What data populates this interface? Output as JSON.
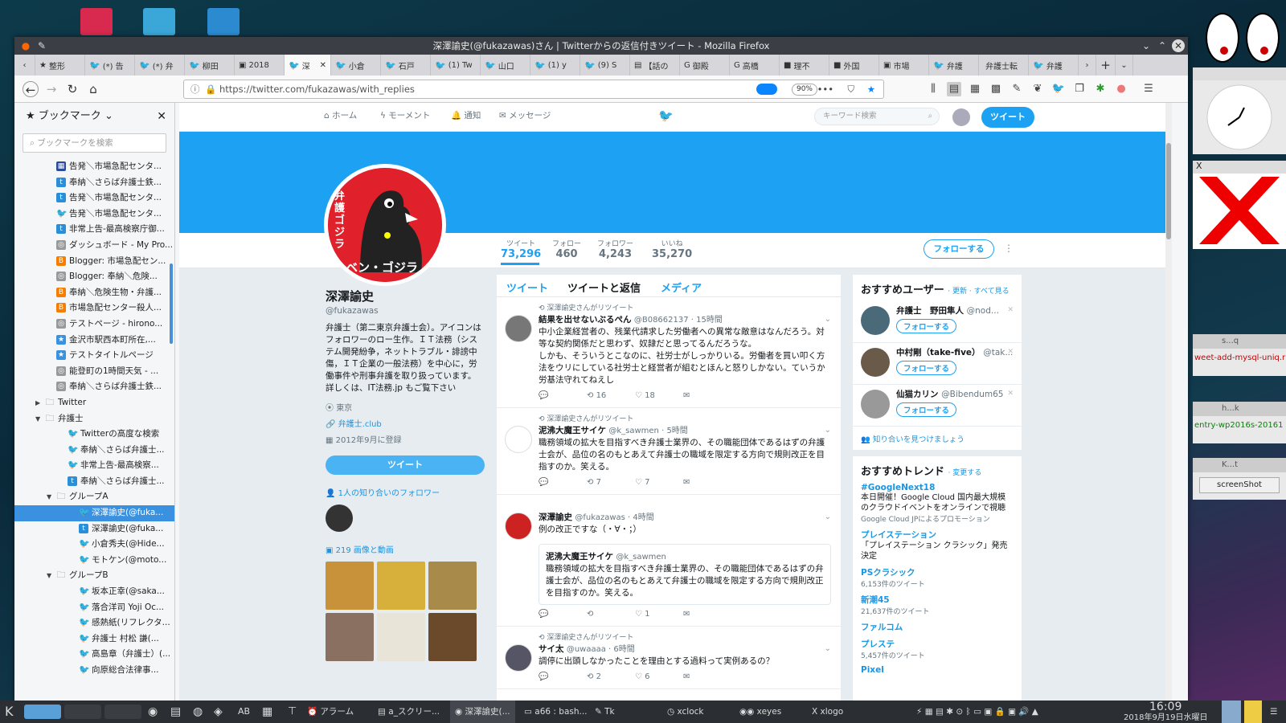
{
  "window_title": "深澤諭史(@fukazawas)さん | Twitterからの返信付きツイート - Mozilla Firefox",
  "tabs": [
    {
      "label": "整形",
      "icon": "star"
    },
    {
      "label": "(*) 告",
      "icon": "twitter"
    },
    {
      "label": "(*) 弁",
      "icon": "twitter"
    },
    {
      "label": "柳田",
      "icon": "twitter"
    },
    {
      "label": "2018",
      "icon": "photo"
    },
    {
      "label": "深",
      "icon": "twitter",
      "active": true
    },
    {
      "label": "小倉",
      "icon": "twitter"
    },
    {
      "label": "石戸",
      "icon": "twitter"
    },
    {
      "label": "(1) Tw",
      "icon": "twitter"
    },
    {
      "label": "山口",
      "icon": "twitter"
    },
    {
      "label": "(1) y",
      "icon": "twitter"
    },
    {
      "label": "(9) S",
      "icon": "twitter"
    },
    {
      "label": "【話の",
      "icon": "news"
    },
    {
      "label": "御殿",
      "icon": "g"
    },
    {
      "label": "高橋",
      "icon": "g"
    },
    {
      "label": "理不",
      "icon": "blue"
    },
    {
      "label": "外国",
      "icon": "blue"
    },
    {
      "label": "市場",
      "icon": "photo"
    },
    {
      "label": "弁護",
      "icon": "twitter"
    },
    {
      "label": "弁護士転",
      "icon": "none"
    },
    {
      "label": "弁護",
      "icon": "twitter"
    }
  ],
  "url": "https://twitter.com/fukazawas/with_replies",
  "zoom": "90%",
  "sidebar": {
    "title": "ブックマーク",
    "search_placeholder": "ブックマークを検索",
    "items": [
      {
        "label": "告発＼市場急配センタ...",
        "icon": "nv",
        "indent": 1
      },
      {
        "label": "奉納＼さらば弁護士鉄...",
        "icon": "bl",
        "indent": 1
      },
      {
        "label": "告発＼市場急配センタ...",
        "icon": "bl",
        "indent": 1
      },
      {
        "label": "告発＼市場急配センタ...",
        "icon": "tw",
        "indent": 1
      },
      {
        "label": "非常上告-最高検察庁御...",
        "icon": "bl",
        "indent": 1
      },
      {
        "label": "ダッシュボード - My Pro...",
        "icon": "gr",
        "indent": 1
      },
      {
        "label": "Blogger: 市場急配セン...",
        "icon": "or",
        "indent": 1
      },
      {
        "label": "Blogger: 奉納＼危険...",
        "icon": "gr",
        "indent": 1
      },
      {
        "label": "奉納＼危険生物・弁護...",
        "icon": "or",
        "indent": 1
      },
      {
        "label": "市場急配センター殺人...",
        "icon": "or",
        "indent": 1
      },
      {
        "label": "テストページ - hirono...",
        "icon": "gr",
        "indent": 1
      },
      {
        "label": "金沢市駅西本町所在,...",
        "icon": "st",
        "indent": 1
      },
      {
        "label": "テストタイトルページ",
        "icon": "st",
        "indent": 1
      },
      {
        "label": "能登町の1時間天気 - ...",
        "icon": "gr",
        "indent": 1
      },
      {
        "label": "奉納＼さらば弁護士鉄...",
        "icon": "gr",
        "indent": 1
      },
      {
        "label": "Twitter",
        "icon": "fd",
        "indent": 0,
        "arrow": "▶"
      },
      {
        "label": "弁護士",
        "icon": "fd",
        "indent": 0,
        "arrow": "▼"
      },
      {
        "label": "Twitterの高度な検索",
        "icon": "tw",
        "indent": 2
      },
      {
        "label": "奉納＼さらば弁護士...",
        "icon": "tw",
        "indent": 2
      },
      {
        "label": "非常上告-最高検察...",
        "icon": "tw",
        "indent": 2
      },
      {
        "label": "奉納＼さらば弁護士...",
        "icon": "bl",
        "indent": 2
      },
      {
        "label": "グループA",
        "icon": "fd",
        "indent": 1,
        "arrow": "▼"
      },
      {
        "label": "深澤諭史(@fuka...",
        "icon": "tw",
        "indent": 3,
        "selected": true
      },
      {
        "label": "深澤諭史(@fuka...",
        "icon": "bl",
        "indent": 3
      },
      {
        "label": "小倉秀夫(@Hide...",
        "icon": "tw",
        "indent": 3
      },
      {
        "label": "モトケン(@moto...",
        "icon": "tw",
        "indent": 3
      },
      {
        "label": "グループB",
        "icon": "fd",
        "indent": 1,
        "arrow": "▼"
      },
      {
        "label": "坂本正幸(@saka...",
        "icon": "tw",
        "indent": 3
      },
      {
        "label": "落合洋司 Yoji Oc...",
        "icon": "tw",
        "indent": 3
      },
      {
        "label": "感熱紙(リフレクタ...",
        "icon": "tw",
        "indent": 3
      },
      {
        "label": "弁護士 村松 謙(...",
        "icon": "tw",
        "indent": 3
      },
      {
        "label": "高島章（弁護士）(...",
        "icon": "tw",
        "indent": 3
      },
      {
        "label": "向原総合法律事...",
        "icon": "tw",
        "indent": 3
      }
    ]
  },
  "twitter_nav": {
    "home": "ホーム",
    "moments": "モーメント",
    "notifications": "通知",
    "messages": "メッセージ",
    "search_placeholder": "キーワード検索",
    "tweet_button": "ツイート"
  },
  "avatar_text": "弁護ゴジラ",
  "avatar_text2": "ベン・ゴジラ",
  "stats": [
    {
      "label": "ツイート",
      "value": "73,296"
    },
    {
      "label": "フォロー",
      "value": "460"
    },
    {
      "label": "フォロワー",
      "value": "4,243"
    },
    {
      "label": "いいね",
      "value": "35,270"
    }
  ],
  "follow_button": "フォローする",
  "profile": {
    "name": "深澤諭史",
    "handle": "@fukazawas",
    "bio": "弁護士（第二東京弁護士会）。アイコンはフォロワーのロー生作。ＩＴ法務（システム開発紛争，ネットトラブル・誹謗中傷，ＩＴ企業の一般法務）を中心に，労働事件や刑事弁護を取り扱っています。 詳しくは、IT法務.jp もご覧下さい",
    "location": "東京",
    "website": "弁護士.club",
    "joined": "2012年9月に登録",
    "tweet_button": "ツイート",
    "followers_you_know": "1人の知り合いのフォロワー",
    "media": "219 画像と動画"
  },
  "timeline": {
    "tabs": [
      "ツイート",
      "ツイートと返信",
      "メディア"
    ],
    "tweets": [
      {
        "retweet_note": "深澤諭史さんがリツイート",
        "name": "結果を出せないぶるぺん",
        "handle": "@B08662137",
        "time": "15時間",
        "text": "中小企業経営者の、残業代請求した労働者への異常な敵意はなんだろう。対等な契約関係だと思わず、奴隷だと思ってるんだろうな。\nしかも、そういうとこなのに、社労士がしっかりいる。労働者を買い叩く方法をウリにしている社労士と経営者が組むとほんと怒りしかない。ていうか労基法守れてねえし",
        "retweets": "16",
        "likes": "18"
      },
      {
        "retweet_note": "深澤諭史さんがリツイート",
        "name": "泥沸大魔王サイケ",
        "handle": "@k_sawmen",
        "time": "5時間",
        "text": "職務領域の拡大を目指すべき弁護士業界の、その職能団体であるはずの弁護士会が、品位の名のもとあえて弁護士の職域を限定する方向で規則改正を目指すのか。笑える。",
        "retweets": "7",
        "likes": "7"
      },
      {
        "retweet_note": "",
        "name": "深澤諭史",
        "handle": "@fukazawas",
        "time": "4時間",
        "text": "例の改正ですな（・∀・；）",
        "quote_name": "泥沸大魔王サイケ",
        "quote_handle": "@k_sawmen",
        "quote_text": "職務領域の拡大を目指すべき弁護士業界の、その職能団体であるはずの弁護士会が、品位の名のもとあえて弁護士の職域を限定する方向で規則改正を目指すのか。笑える。",
        "retweets": "",
        "likes": "1"
      },
      {
        "retweet_note": "深澤諭史さんがリツイート",
        "name": "サイ太",
        "handle": "@uwaaaa",
        "time": "6時間",
        "text": "調停に出頭しなかったことを理由とする過料って実例あるの？",
        "retweets": "2",
        "likes": "6"
      }
    ]
  },
  "who_to_follow": {
    "title": "おすすめユーザー",
    "links": "· 更新 · すべて見る",
    "users": [
      {
        "name": "弁護士　野田隼人",
        "handle": "@nod...",
        "button": "フォローする"
      },
      {
        "name": "中村剛（take-five）",
        "handle": "@tak...",
        "button": "フォローする"
      },
      {
        "name": "仙猫カリン",
        "handle": "@Bibendum65",
        "button": "フォローする"
      }
    ],
    "find_friends": "知り合いを見つけましょう"
  },
  "trends": {
    "title": "おすすめトレンド",
    "change": "· 変更する",
    "items": [
      {
        "tag": "#GoogleNext18",
        "desc": "本日開催！Google Cloud 国内最大規模のクラウドイベントをオンラインで視聴",
        "count": "Google Cloud JPによるプロモーション"
      },
      {
        "tag": "プレイステーション",
        "desc": "「プレイステーション クラシック」発売決定",
        "count": ""
      },
      {
        "tag": "PSクラシック",
        "desc": "",
        "count": "6,153件のツイート"
      },
      {
        "tag": "新潮45",
        "desc": "",
        "count": "21,637件のツイート"
      },
      {
        "tag": "ファルコム",
        "desc": "",
        "count": ""
      },
      {
        "tag": "プレステ",
        "desc": "",
        "count": "5,457件のツイート"
      },
      {
        "tag": "Pixel",
        "desc": "",
        "count": ""
      }
    ]
  },
  "side_windows": {
    "w1_title": "s...q",
    "w1_text": "weet-add-mysql-uniq.r",
    "w2_title": "h...k",
    "w2_text": "entry-wp2016s-20161",
    "w3_title": "K...t",
    "w3_button": "screenShot"
  },
  "taskbar": {
    "items": [
      "アラーム",
      "a_スクリー...",
      "深澤諭史(...",
      "a66 : bash...",
      "Tk",
      "xclock",
      "xeyes",
      "xlogo"
    ],
    "time": "16:09",
    "date": "2018年9月19日水曜日"
  },
  "colors": {
    "twitter_blue": "#1da1f2",
    "link": "#1b95e0",
    "selection": "#3a91e0"
  }
}
